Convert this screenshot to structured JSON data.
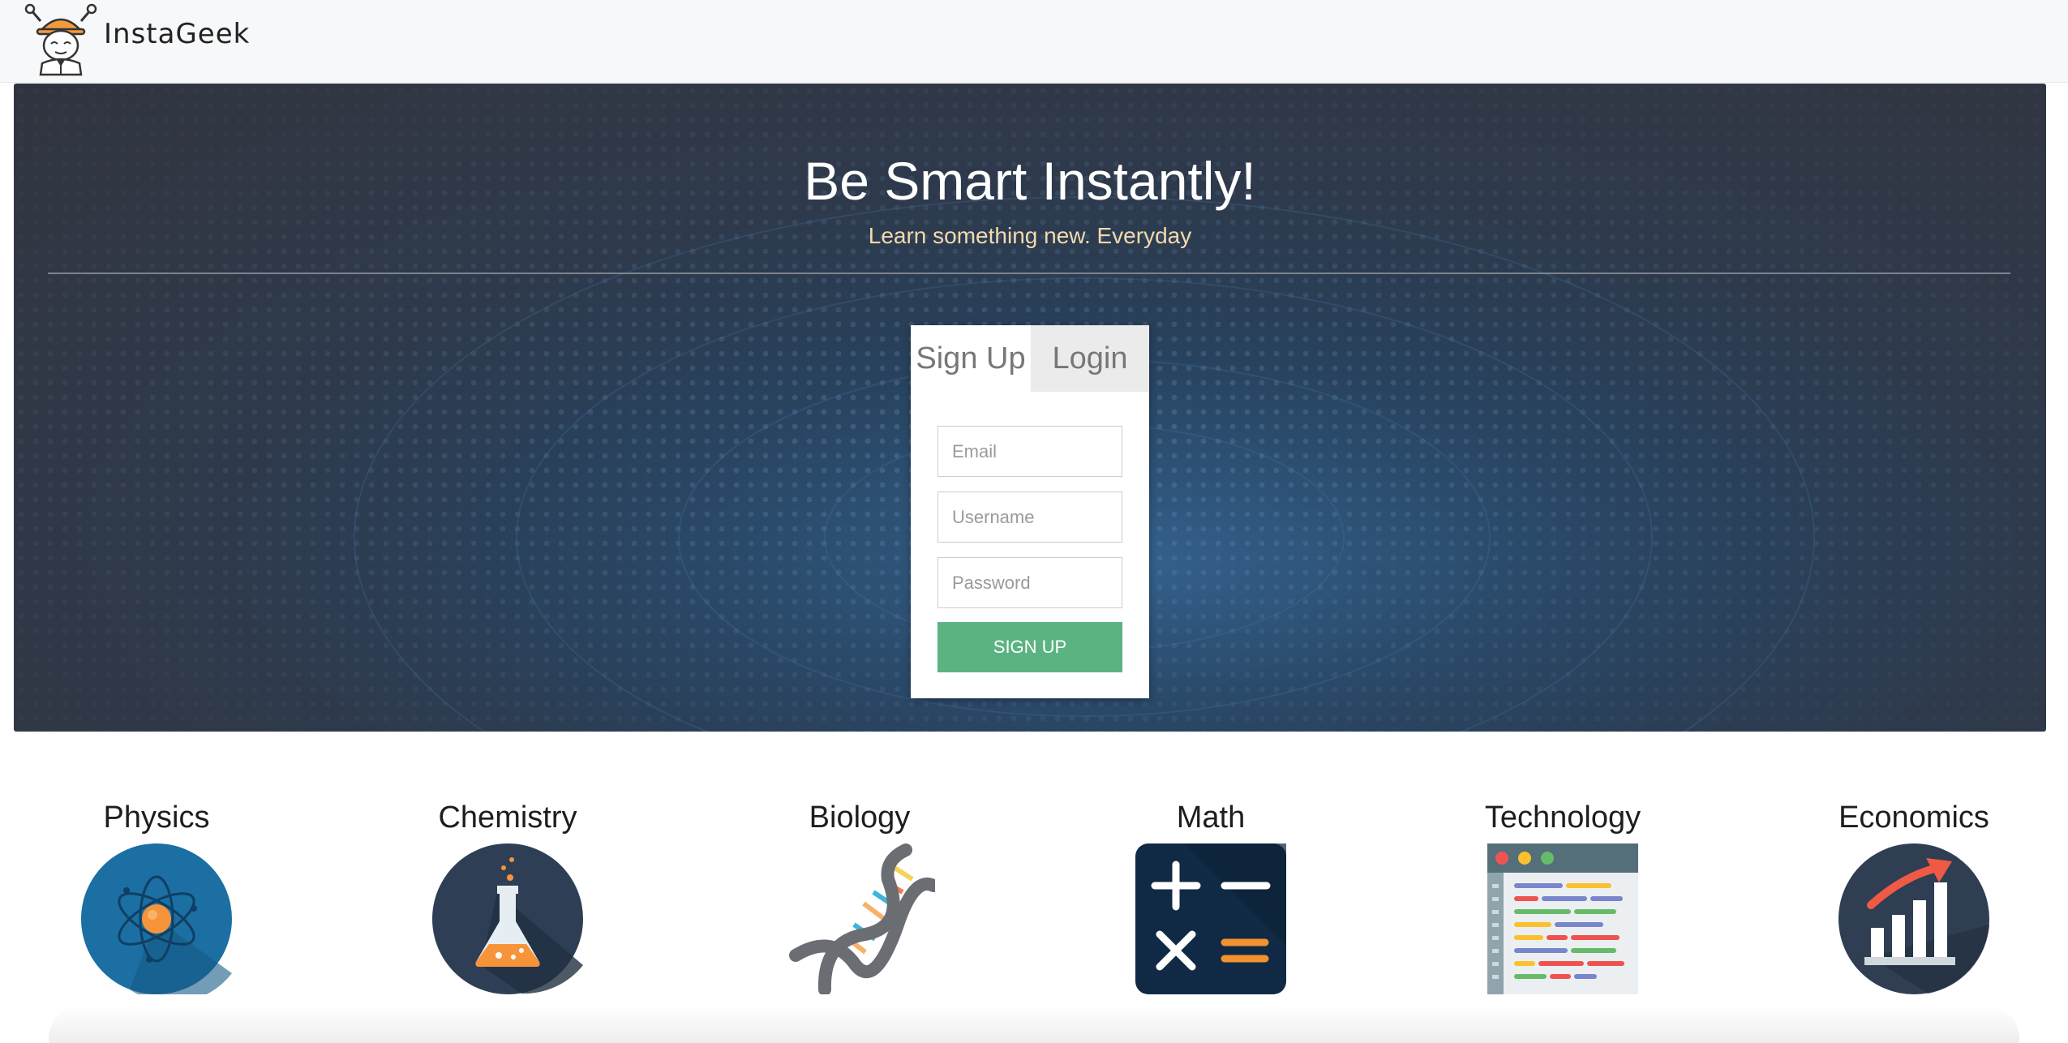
{
  "navbar": {
    "brand": "InstaGeek",
    "logo_icon": "geek-mascot-icon"
  },
  "hero": {
    "title": "Be Smart Instantly!",
    "subtitle": "Learn something new. Everyday"
  },
  "auth": {
    "tabs": [
      {
        "label": "Sign Up",
        "active": true
      },
      {
        "label": "Login",
        "active": false
      }
    ],
    "email_placeholder": "Email",
    "username_placeholder": "Username",
    "password_placeholder": "Password",
    "submit_label": "SIGN UP"
  },
  "subjects": [
    {
      "label": "Physics",
      "icon": "atom-icon"
    },
    {
      "label": "Chemistry",
      "icon": "flask-icon"
    },
    {
      "label": "Biology",
      "icon": "dna-icon"
    },
    {
      "label": "Math",
      "icon": "math-operators-icon"
    },
    {
      "label": "Technology",
      "icon": "code-window-icon"
    },
    {
      "label": "Economics",
      "icon": "growth-chart-icon"
    }
  ],
  "colors": {
    "accent_green": "#5cb382",
    "subtitle_cream": "#f4d9ad",
    "hero_dark": "#30343f"
  }
}
